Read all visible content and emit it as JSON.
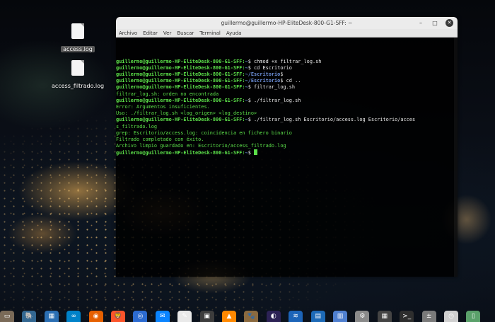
{
  "desktop": {
    "icons": [
      {
        "label": "access.log",
        "icon": "text-file-icon"
      },
      {
        "label": "access_filtrado.log",
        "icon": "text-file-icon"
      }
    ]
  },
  "terminal": {
    "title": "guillermo@guillermo-HP-EliteDesk-800-G1-SFF: ~",
    "menu": [
      "Archivo",
      "Editar",
      "Ver",
      "Buscar",
      "Terminal",
      "Ayuda"
    ],
    "controls": {
      "minimize": "–",
      "maximize": "□",
      "close": "✕"
    },
    "lines": [
      {
        "prompt": "guillermo@guillermo-HP-EliteDesk-800-G1-SFF:",
        "path": "~",
        "cmd": "$ chmod +x filtrar_log.sh"
      },
      {
        "prompt": "guillermo@guillermo-HP-EliteDesk-800-G1-SFF:",
        "path": "~",
        "cmd": "$ cd Escritorio"
      },
      {
        "prompt": "guillermo@guillermo-HP-EliteDesk-800-G1-SFF:",
        "path": "~/Escritorio",
        "cmd": "$"
      },
      {
        "prompt": "guillermo@guillermo-HP-EliteDesk-800-G1-SFF:",
        "path": "~/Escritorio",
        "cmd": "$ cd .."
      },
      {
        "prompt": "guillermo@guillermo-HP-EliteDesk-800-G1-SFF:",
        "path": "~",
        "cmd": "$ filtrar_log.sh"
      },
      {
        "out": "filtrar_log.sh: orden no encontrada"
      },
      {
        "prompt": "guillermo@guillermo-HP-EliteDesk-800-G1-SFF:",
        "path": "~",
        "cmd": "$ ./filtrar_log.sh"
      },
      {
        "out": "Error: Argumentos insuficientes."
      },
      {
        "out": "Uso: ./filtrar_log.sh <log_origen> <log_destino>"
      },
      {
        "prompt": "guillermo@guillermo-HP-EliteDesk-800-G1-SFF:",
        "path": "~",
        "cmd": "$ ./filtrar_log.sh Escritorio/access.log Escritorio/acces"
      },
      {
        "out": "s_filtrado.log"
      },
      {
        "out": "grep: Escritorio/access.log: coincidencia en fichero binario"
      },
      {
        "out": "Filtrado completado con éxito."
      },
      {
        "out": "Archivo limpio guardado en: Escritorio/access_filtrado.log"
      },
      {
        "prompt": "guillermo@guillermo-HP-EliteDesk-800-G1-SFF:",
        "path": "~",
        "cmd": "$ ",
        "cursor": true
      }
    ]
  },
  "dock": {
    "items": [
      {
        "name": "files-icon",
        "color": "#7a6a58",
        "glyph": "▭"
      },
      {
        "name": "postgresql-icon",
        "color": "#336791",
        "glyph": "🐘"
      },
      {
        "name": "calculator-app-icon",
        "color": "#2b6fb3",
        "glyph": "▦"
      },
      {
        "name": "nextcloud-icon",
        "color": "#0082c9",
        "glyph": "∞"
      },
      {
        "name": "firefox-icon",
        "color": "#e66000",
        "glyph": "◉"
      },
      {
        "name": "brave-icon",
        "color": "#fb542b",
        "glyph": "🦁"
      },
      {
        "name": "chromium-icon",
        "color": "#2c6bd1",
        "glyph": "◎"
      },
      {
        "name": "thunderbird-icon",
        "color": "#0a84ff",
        "glyph": "✉"
      },
      {
        "name": "text-editor-icon",
        "color": "#e9e9e9",
        "glyph": "✎"
      },
      {
        "name": "photo-icon",
        "color": "#3d3d3d",
        "glyph": "▣"
      },
      {
        "name": "vlc-icon",
        "color": "#ff8800",
        "glyph": "▲"
      },
      {
        "name": "gimp-icon",
        "color": "#8b6a3f",
        "glyph": "🐾"
      },
      {
        "name": "eclipse-icon",
        "color": "#2c2255",
        "glyph": "◐"
      },
      {
        "name": "wireshark-icon",
        "color": "#1c64b8",
        "glyph": "≋"
      },
      {
        "name": "libreoffice-writer-icon",
        "color": "#1d6ab7",
        "glyph": "▤"
      },
      {
        "name": "document-viewer-icon",
        "color": "#4f7fcf",
        "glyph": "▥"
      },
      {
        "name": "settings-icon",
        "color": "#8a8a8a",
        "glyph": "⚙"
      },
      {
        "name": "system-monitor-icon",
        "color": "#444",
        "glyph": "▦"
      },
      {
        "name": "terminal-icon",
        "color": "#2e2e2e",
        "glyph": ">_"
      },
      {
        "name": "calculator-icon",
        "color": "#7a7a7a",
        "glyph": "±"
      },
      {
        "name": "clock-icon",
        "color": "#cfcfcf",
        "glyph": "◷"
      },
      {
        "name": "trash-icon",
        "color": "#5aa06a",
        "glyph": "▯"
      }
    ]
  }
}
